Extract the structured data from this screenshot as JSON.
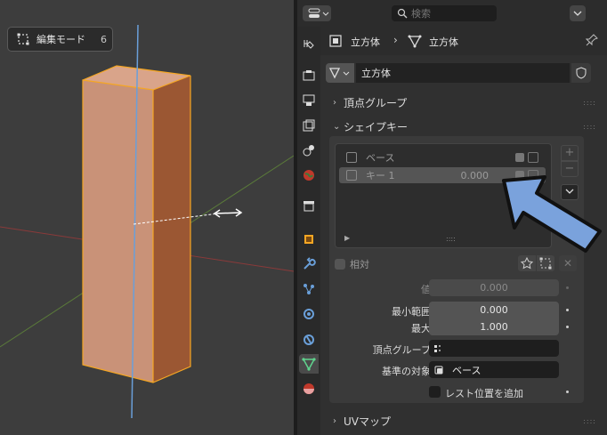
{
  "viewport": {
    "mode_label": "編集モード",
    "mode_count": "6"
  },
  "header": {
    "search_placeholder": "検索"
  },
  "breadcrumb": {
    "object_name": "立方体",
    "mesh_name": "立方体"
  },
  "datablock": {
    "name": "立方体"
  },
  "panels": {
    "vertex_groups": "頂点グループ",
    "shape_keys": "シェイプキー",
    "uv_maps": "UVマップ"
  },
  "shape_keys": {
    "items": [
      {
        "name": "ベース",
        "value": ""
      },
      {
        "name": "キー 1",
        "value": "0.000"
      }
    ],
    "add_label": "+",
    "remove_label": "−"
  },
  "settings": {
    "relative_label": "相対",
    "value_label": "値",
    "value": "0.000",
    "range_min_label": "最小範囲",
    "range_min": "0.000",
    "range_max_label": "最大",
    "range_max": "1.000",
    "vertex_group_label": "頂点グループ",
    "relative_to_label": "基準の対象",
    "relative_to_value": "ベース",
    "add_rest_label": "レスト位置を追加"
  },
  "colors": {
    "accent": "#5680c2",
    "cube_face": "#c99278",
    "cube_side": "#9b5733",
    "edge_select": "#f5a623",
    "z_axis": "#6a9fd9",
    "x_axis": "#8a3a3a",
    "y_axis": "#5a7a3a",
    "arrow_fill": "#7aa2dc"
  }
}
